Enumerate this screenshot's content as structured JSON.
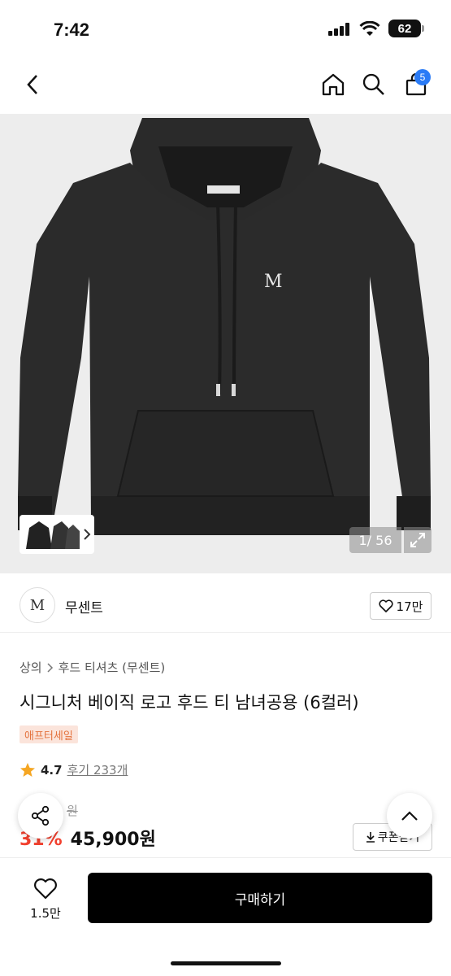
{
  "status_bar": {
    "time": "7:42",
    "battery": "62"
  },
  "nav": {
    "cart_count": "5"
  },
  "gallery": {
    "counter": "1/ 56"
  },
  "brand": {
    "logo_text": "M",
    "name": "무센트",
    "likes": "17만"
  },
  "product": {
    "breadcrumb": [
      "상의",
      "후드 티셔츠 (무센트)"
    ],
    "title": "시그니처 베이직 로고 후드 티 남녀공용 (6컬러)",
    "badge": "애프터세일",
    "rating": "4.7",
    "reviews": "후기 233개",
    "original_price": "원",
    "discount": "31%",
    "price": "45,900원",
    "coupon_label": "쿠폰받기"
  },
  "bottom": {
    "wish_count": "1.5만",
    "buy_label": "구매하기"
  },
  "colors": {
    "accent": "#2a7bf6",
    "discount": "#f2402e",
    "badge_bg": "#fbe4db",
    "badge_text": "#e4743f",
    "star": "#f5a623"
  }
}
